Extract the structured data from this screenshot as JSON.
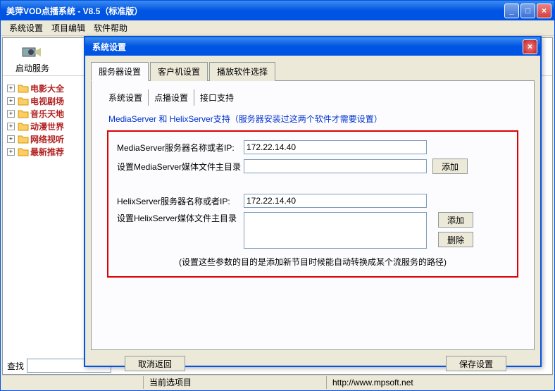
{
  "window": {
    "title": "美萍VOD点播系统 - V8.5（标准版）",
    "min": "_",
    "max": "□",
    "close": "×"
  },
  "menu": {
    "system": "系统设置",
    "project": "项目编辑",
    "help": "软件帮助"
  },
  "toolbar": {
    "start_service": "启动服务"
  },
  "tree": {
    "items": [
      {
        "label": "电影大全"
      },
      {
        "label": "电视剧场"
      },
      {
        "label": "音乐天地"
      },
      {
        "label": "动漫世界"
      },
      {
        "label": "网络视听"
      },
      {
        "label": "最新推荐"
      }
    ]
  },
  "search": {
    "label": "查找",
    "value": ""
  },
  "statusbar": {
    "current": "当前选项目",
    "url": "http://www.mpsoft.net"
  },
  "dialog": {
    "title": "系统设置",
    "close": "×",
    "tabs": {
      "server": "服务器设置",
      "client": "客户机设置",
      "player": "播放软件选择"
    },
    "subtabs": {
      "sys": "系统设置",
      "vod": "点播设置",
      "port": "接口支持"
    },
    "group_title": "MediaServer 和 HelixServer支持（服务器安装过这两个软件才需要设置）",
    "media": {
      "ip_label": "MediaServer服务器名称或者IP:",
      "ip_value": "172.22.14.40",
      "dir_label": "设置MediaServer媒体文件主目录",
      "dir_value": "",
      "add": "添加"
    },
    "helix": {
      "ip_label": "HelixServer服务器名称或者IP:",
      "ip_value": "172.22.14.40",
      "dir_label": "设置HelixServer媒体文件主目录",
      "dir_value": "",
      "add": "添加",
      "del": "删除"
    },
    "hint": "(设置这些参数的目的是添加新节目时候能自动转换成某个流服务的路径)",
    "footer": {
      "cancel": "取消返回",
      "save": "保存设置"
    }
  }
}
